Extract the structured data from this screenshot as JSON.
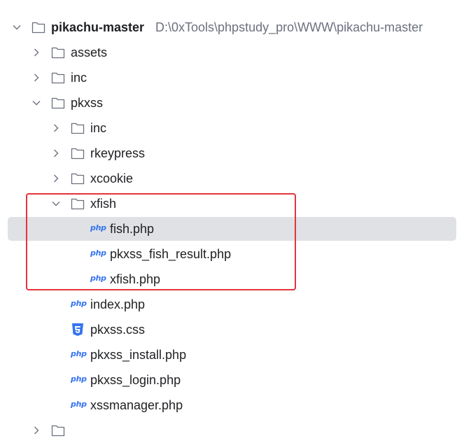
{
  "project": {
    "name": "pikachu-master",
    "path": "D:\\0xTools\\phpstudy_pro\\WWW\\pikachu-master"
  },
  "tree": {
    "assets": "assets",
    "inc": "inc",
    "pkxss": "pkxss",
    "pkxss_inc": "inc",
    "rkeypress": "rkeypress",
    "xcookie": "xcookie",
    "xfish": "xfish",
    "fish_php": "fish.php",
    "pkxss_fish_result_php": "pkxss_fish_result.php",
    "xfish_php": "xfish.php",
    "index_php": "index.php",
    "pkxss_css": "pkxss.css",
    "pkxss_install_php": "pkxss_install.php",
    "pkxss_login_php": "pkxss_login.php",
    "xssmanager_php": "xssmanager.php"
  },
  "icons": {
    "php_badge": "php",
    "folder": "folder-icon",
    "css": "css-file-icon"
  },
  "colors": {
    "selection": "#dfe1e5",
    "highlight_border": "#e5333a",
    "php_icon": "#3574f0",
    "css_icon": "#3574f0",
    "path_text": "#6c707e"
  },
  "selected_item": "fish.php"
}
